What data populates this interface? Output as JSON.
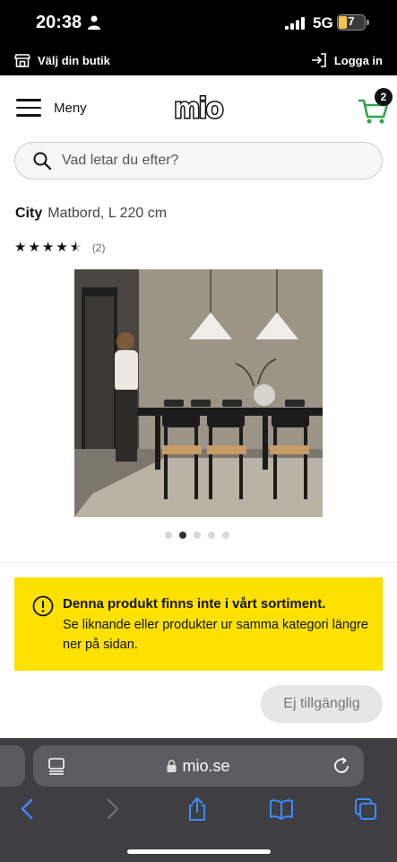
{
  "status_bar": {
    "time": "20:38",
    "network": "5G",
    "battery": "7"
  },
  "store_bar": {
    "choose_store": "Välj din butik",
    "login": "Logga in"
  },
  "header": {
    "menu_label": "Meny",
    "logo_text": "mio",
    "cart_count": "2"
  },
  "search": {
    "placeholder": "Vad letar du efter?"
  },
  "product": {
    "brand": "City",
    "name": "Matbord, L 220 cm",
    "rating": 4.5,
    "rating_max": 5,
    "review_count": "(2)",
    "image_count": 5,
    "active_image": 2
  },
  "notice": {
    "title": "Denna produkt finns inte i vårt sortiment.",
    "body": "Se liknande eller produkter ur samma kategori längre ner på sidan."
  },
  "buy_button": {
    "label": "Ej tillgänglig"
  },
  "browser": {
    "url": "mio.se"
  },
  "colors": {
    "notice_yellow": "#fde100",
    "cart_green": "#2ea44f",
    "browser_bar": "#3e3e43",
    "toolbar_blue": "#3d8cff"
  }
}
